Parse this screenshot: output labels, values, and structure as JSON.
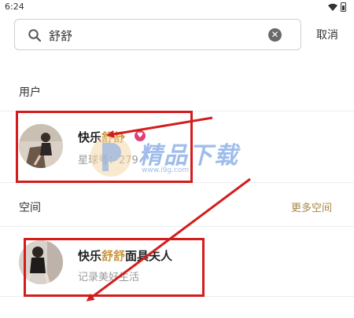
{
  "status_bar": {
    "time": "6:24",
    "icons": [
      "wifi-icon",
      "battery-icon"
    ]
  },
  "search": {
    "query": "舒舒",
    "icon": "search-icon",
    "clear_icon": "clear-icon"
  },
  "cancel_label": "取消",
  "users_section": {
    "title": "用户",
    "items": [
      {
        "name_prefix": "快乐",
        "name_highlight": "舒舒",
        "name_suffix": "",
        "badge": "vip-badge",
        "sub": "星球号：279"
      }
    ]
  },
  "space_section": {
    "title": "空间",
    "more_label": "更多空间",
    "items": [
      {
        "name_prefix": "快乐",
        "name_highlight": "舒舒",
        "name_suffix": "面具夫人",
        "sub": "记录美好生活"
      }
    ]
  },
  "watermark": {
    "text": "精品下载",
    "url": "www.i9g.com"
  },
  "colors": {
    "highlight": "#c8963f",
    "annotation_red": "#d41c1c",
    "more_link": "#a88547"
  }
}
